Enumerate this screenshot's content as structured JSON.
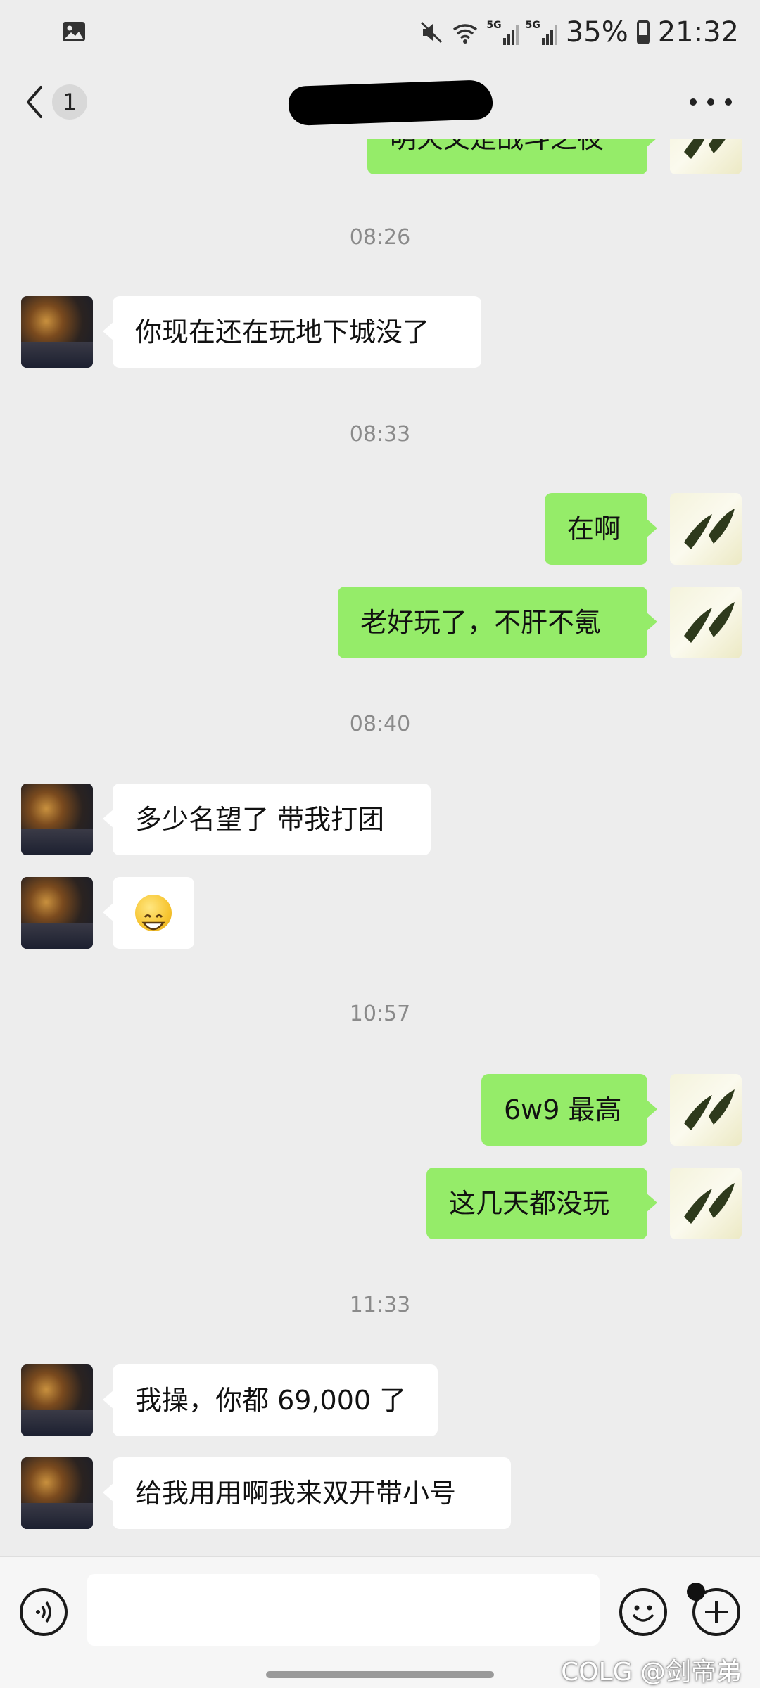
{
  "status_bar": {
    "battery": "35%",
    "time": "21:32",
    "icons": [
      "image-icon",
      "mute-icon",
      "wifi-icon",
      "signal-5g-icon",
      "signal-5g-icon",
      "battery-icon"
    ],
    "network_labels": [
      "5G",
      "5G"
    ]
  },
  "header": {
    "back_label": "",
    "unread_count": "1",
    "title": "",
    "more_label": "..."
  },
  "partial_top_message": "明天又是战斗之夜",
  "messages": [
    {
      "type": "time",
      "text": "08:26"
    },
    {
      "type": "in",
      "text": "你现在还在玩地下城没了"
    },
    {
      "type": "time",
      "text": "08:33"
    },
    {
      "type": "out",
      "text": "在啊"
    },
    {
      "type": "out",
      "text": "老好玩了，不肝不氪"
    },
    {
      "type": "time",
      "text": "08:40"
    },
    {
      "type": "in",
      "text": "多少名望了 带我打团"
    },
    {
      "type": "in",
      "text": "",
      "emoji": "grinning-face-emoji"
    },
    {
      "type": "time",
      "text": "10:57"
    },
    {
      "type": "out",
      "text": "6w9 最高"
    },
    {
      "type": "out",
      "text": "这几天都没玩"
    },
    {
      "type": "time",
      "text": "11:33"
    },
    {
      "type": "in",
      "text": "我操，你都 69,000 了"
    },
    {
      "type": "in",
      "text": "给我用用啊我来双开带小号"
    }
  ],
  "input_bar": {
    "text_value": "",
    "watermark": "COLG @剑帝弟"
  },
  "colors": {
    "background": "#ededed",
    "outgoing_bubble": "#95ec69",
    "incoming_bubble": "#ffffff",
    "timestamp_text": "#8a8a8a"
  }
}
